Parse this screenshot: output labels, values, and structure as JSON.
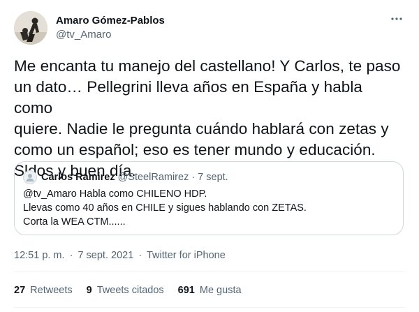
{
  "author": {
    "display_name": "Amaro Gómez-Pablos",
    "handle": "@tv_Amaro",
    "avatar_icon": "person-avatar-icon"
  },
  "more_icon": "ellipsis-icon",
  "tweet": {
    "text": "Me encanta tu manejo del castellano! Y Carlos, te paso\nun dato… Pellegrini lleva años en España y habla como\nquiere. Nadie le pregunta cuándo hablará con zetas y\ncomo un español; eso es tener mundo y educación.\nSldos y buen día."
  },
  "quoted_tweet": {
    "display_name": "Carlos Ramirez",
    "handle": "@SteelRamirez",
    "separator": "·",
    "date": "7 sept.",
    "avatar_icon": "default-avatar-icon",
    "text": "@tv_Amaro Habla como CHILENO HDP.\nLlevas como 40 años en CHILE y sigues hablando con ZETAS.\nCorta la WEA CTM......"
  },
  "meta": {
    "time": "12:51 p. m.",
    "separator1": "·",
    "date": "7 sept. 2021",
    "separator2": "·",
    "source": "Twitter for iPhone"
  },
  "stats": {
    "retweets_count": "27",
    "retweets_label": "Retweets",
    "quotes_count": "9",
    "quotes_label": "Tweets citados",
    "likes_count": "691",
    "likes_label": "Me gusta"
  },
  "colors": {
    "text_primary": "#0f1419",
    "text_secondary": "#536471",
    "border": "#cfd9de"
  }
}
